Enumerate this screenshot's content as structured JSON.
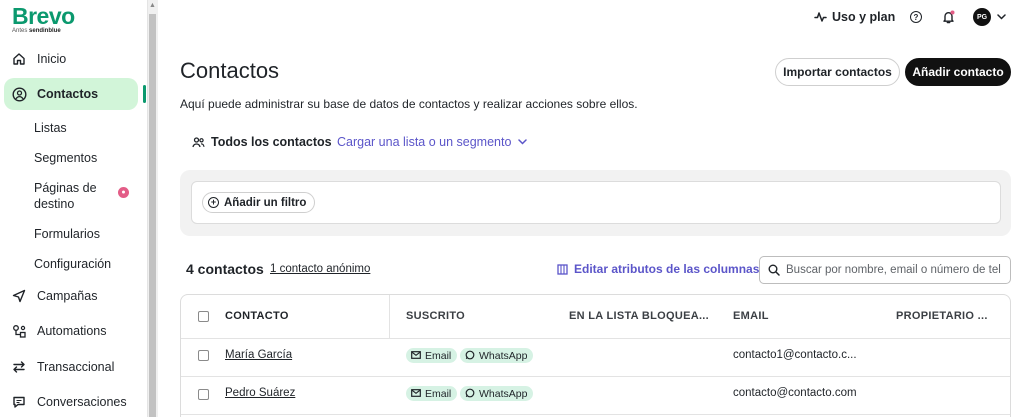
{
  "brand": {
    "name": "Brevo",
    "formerly": "Antes",
    "formerly_brand": "sendinblue"
  },
  "sidebar": {
    "items": [
      {
        "label": "Inicio",
        "icon": "home-icon"
      },
      {
        "label": "Contactos",
        "icon": "contacts-icon"
      },
      {
        "label": "Campañas",
        "icon": "send-icon"
      },
      {
        "label": "Automations",
        "icon": "automation-icon"
      },
      {
        "label": "Transaccional",
        "icon": "transfer-icon"
      },
      {
        "label": "Conversaciones",
        "icon": "chat-icon"
      }
    ],
    "subitems": [
      "Listas",
      "Segmentos",
      "Páginas de",
      "destino",
      "Formularios",
      "Configuración"
    ]
  },
  "topbar": {
    "usage_label": "Uso y plan",
    "avatar_initials": "PG"
  },
  "page": {
    "title": "Contactos",
    "subtitle": "Aquí puede administrar su base de datos de contactos y realizar acciones sobre ellos.",
    "import_button": "Importar contactos",
    "add_button": "Añadir contacto"
  },
  "tabs": {
    "all_contacts": "Todos los contactos",
    "load_list": "Cargar una lista o un segmento"
  },
  "filter": {
    "add_filter": "Añadir un filtro"
  },
  "summary": {
    "count": "4 contactos",
    "anonymous": "1 contacto anónimo",
    "edit_columns": "Editar atributos de las columnas"
  },
  "search": {
    "placeholder": "Buscar por nombre, email o número de teléfono"
  },
  "table": {
    "headers": [
      "CONTACTO",
      "SUSCRITO",
      "EN LA LISTA BLOQUEA...",
      "EMAIL",
      "PROPIETARIO ..."
    ],
    "rows": [
      {
        "name": "María García",
        "tags": [
          "Email",
          "WhatsApp"
        ],
        "email": "contacto1@contacto.c..."
      },
      {
        "name": "Pedro Suárez",
        "tags": [
          "Email",
          "WhatsApp"
        ],
        "email": "contacto@contacto.com"
      }
    ]
  },
  "colors": {
    "brand_green": "#0b996e",
    "active_bg": "#d2f5d9",
    "link_purple": "#5b55c9",
    "tag_bg": "#d6f2e4"
  }
}
